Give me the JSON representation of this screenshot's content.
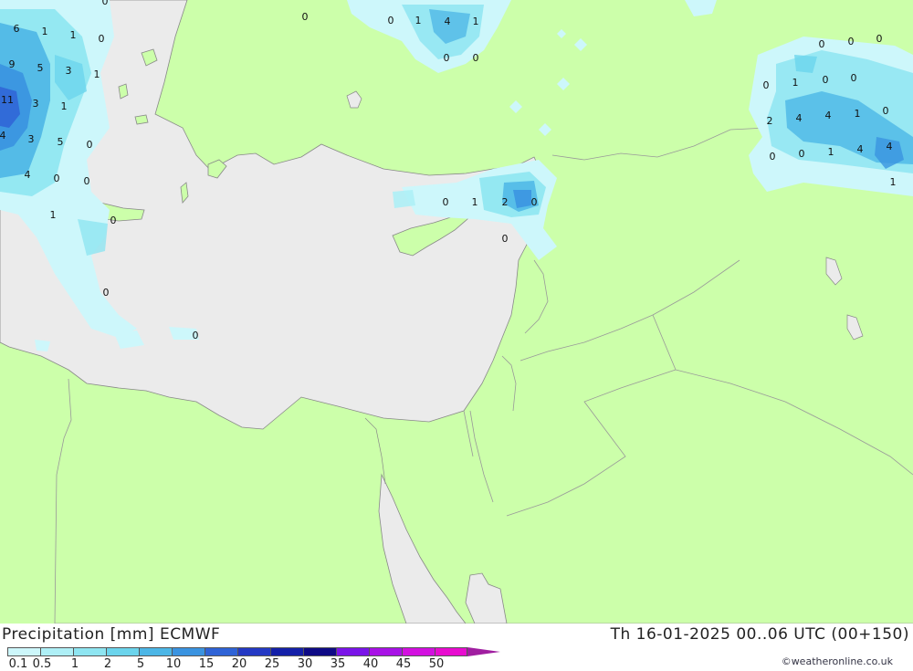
{
  "title_left": "Precipitation [mm] ECMWF",
  "title_right": "Th 16-01-2025 00..06 UTC (00+150)",
  "credit": "©weatheronline.co.uk",
  "colors": {
    "land": "#ccffaa",
    "sea": "#ebebeb",
    "border": "#999999",
    "coast": "#888888"
  },
  "legend": {
    "ticks": [
      "0.1",
      "0.5",
      "1",
      "2",
      "5",
      "10",
      "15",
      "20",
      "25",
      "30",
      "35",
      "40",
      "45",
      "50"
    ],
    "colors": [
      "#cdf7fb",
      "#aeeff6",
      "#8ee5f1",
      "#6bd4ec",
      "#4cb6e6",
      "#3a93e0",
      "#2f63d6",
      "#2439c4",
      "#1420a8",
      "#0e0a85",
      "#7a14e8",
      "#a812e6",
      "#d310e0",
      "#e80cd0",
      "#a01ea0"
    ]
  },
  "precip_values": [
    {
      "v": "6"
    },
    {
      "v": "1"
    },
    {
      "v": "1"
    },
    {
      "v": "0"
    },
    {
      "v": "9"
    },
    {
      "v": "5"
    },
    {
      "v": "3"
    },
    {
      "v": "1"
    },
    {
      "v": "11"
    },
    {
      "v": "3"
    },
    {
      "v": "1"
    },
    {
      "v": "4"
    },
    {
      "v": "3"
    },
    {
      "v": "5"
    },
    {
      "v": "0"
    },
    {
      "v": "4"
    },
    {
      "v": "0"
    },
    {
      "v": "0"
    },
    {
      "v": "1"
    },
    {
      "v": "0"
    },
    {
      "v": "0"
    },
    {
      "v": "0"
    },
    {
      "v": "0"
    },
    {
      "v": "0"
    },
    {
      "v": "1"
    },
    {
      "v": "4"
    },
    {
      "v": "1"
    },
    {
      "v": "0"
    },
    {
      "v": "0"
    },
    {
      "v": "0"
    },
    {
      "v": "1"
    },
    {
      "v": "2"
    },
    {
      "v": "0"
    },
    {
      "v": "0"
    },
    {
      "v": "0"
    },
    {
      "v": "0"
    },
    {
      "v": "0"
    },
    {
      "v": "0"
    },
    {
      "v": "1"
    },
    {
      "v": "0"
    },
    {
      "v": "0"
    },
    {
      "v": "0"
    },
    {
      "v": "2"
    },
    {
      "v": "4"
    },
    {
      "v": "4"
    },
    {
      "v": "1"
    },
    {
      "v": "0"
    },
    {
      "v": "0"
    },
    {
      "v": "0"
    },
    {
      "v": "1"
    },
    {
      "v": "4"
    },
    {
      "v": "4"
    },
    {
      "v": "1"
    }
  ]
}
